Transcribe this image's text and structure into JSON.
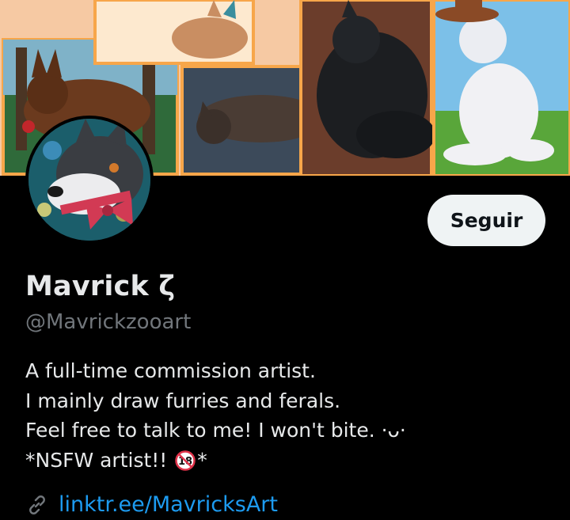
{
  "profile": {
    "display_name": "Mavrick ζ",
    "handle": "@Mavrickzooart",
    "follow_label": "Seguir",
    "bio_lines": [
      "A full-time commission artist.",
      "I mainly draw furries and ferals.",
      "Feel free to talk to me! I won't bite. ·ᴗ·"
    ],
    "bio_nsfw_prefix": "*NSFW artist!! ",
    "bio_nsfw_suffix": "*",
    "nsfw_badge_text": "18",
    "link": "linktr.ee/MavricksArt"
  },
  "icons": {
    "link": "link-icon",
    "nsfw": "no-under-18-icon"
  },
  "colors": {
    "background": "#000000",
    "text": "#e7e9ea",
    "muted": "#71767b",
    "link": "#1d9bf0",
    "button_bg": "#eff3f4",
    "button_text": "#0f1419"
  }
}
